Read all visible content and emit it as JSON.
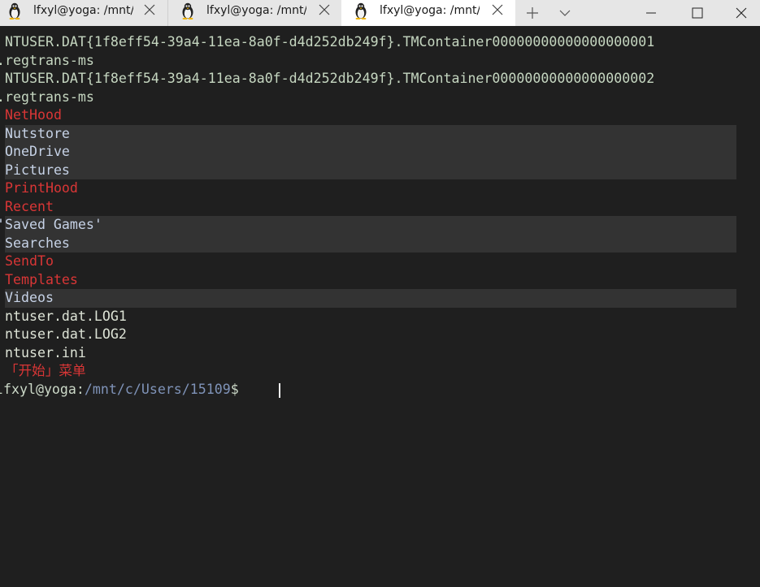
{
  "tabs": [
    {
      "title": "lfxyl@yoga: /mnt/c",
      "active": false
    },
    {
      "title": "lfxyl@yoga: /mnt/c",
      "active": false
    },
    {
      "title": "lfxyl@yoga: /mnt/c",
      "active": true
    }
  ],
  "window_buttons": {
    "new_tab": "new-tab",
    "dropdown": "dropdown",
    "minimize": "minimize",
    "maximize": "maximize",
    "close": "close"
  },
  "terminal": {
    "lines": [
      {
        "text": "NTUSER.DAT{1f8eff54-39a4-11ea-8a0f-d4d252db249f}.TMContainer00000000000000000001",
        "color": "file",
        "highlight": false
      },
      {
        "text": ".regtrans-ms",
        "color": "file",
        "highlight": false
      },
      {
        "text": "NTUSER.DAT{1f8eff54-39a4-11ea-8a0f-d4d252db249f}.TMContainer00000000000000000002",
        "color": "file",
        "highlight": false
      },
      {
        "text": ".regtrans-ms",
        "color": "file",
        "highlight": false
      },
      {
        "text": "NetHood",
        "color": "red",
        "highlight": false
      },
      {
        "text": "Nutstore",
        "color": "blue",
        "highlight": true
      },
      {
        "text": "OneDrive",
        "color": "blue",
        "highlight": true
      },
      {
        "text": "Pictures",
        "color": "blue",
        "highlight": true
      },
      {
        "text": "PrintHood",
        "color": "red",
        "highlight": false
      },
      {
        "text": "Recent",
        "color": "red",
        "highlight": false
      },
      {
        "text": "'Saved Games'",
        "color": "blue",
        "highlight": true
      },
      {
        "text": "Searches",
        "color": "blue",
        "highlight": true
      },
      {
        "text": "SendTo",
        "color": "red",
        "highlight": false
      },
      {
        "text": "Templates",
        "color": "red",
        "highlight": false
      },
      {
        "text": "Videos",
        "color": "blue",
        "highlight": true
      },
      {
        "text": "ntuser.dat.LOG1",
        "color": "plain",
        "highlight": false
      },
      {
        "text": "ntuser.dat.LOG2",
        "color": "plain",
        "highlight": false
      },
      {
        "text": "ntuser.ini",
        "color": "plain",
        "highlight": false
      },
      {
        "text": "「开始」菜单",
        "color": "red",
        "highlight": false
      }
    ],
    "prompt": {
      "user_host": "lfxyl@yoga",
      "separator": ":",
      "path": "/mnt/c/Users/15109",
      "symbol": "$ "
    }
  },
  "colors": {
    "background": "#1f1f1f",
    "highlight_bg": "#333333",
    "red": "#d93636",
    "blue": "#c6d2e6",
    "file": "#c5d6c0",
    "path": "#7f93b8"
  }
}
